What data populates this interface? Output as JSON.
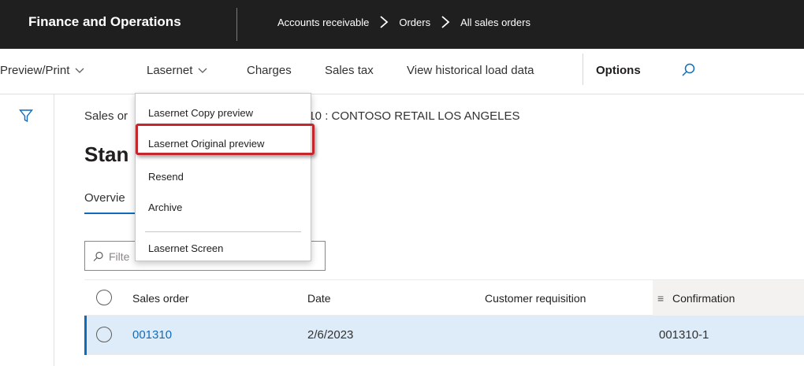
{
  "topbar": {
    "app_title": "Finance and Operations",
    "breadcrumb": [
      "Accounts receivable",
      "Orders",
      "All sales orders"
    ]
  },
  "actions": {
    "preview_print": "Preview/Print",
    "lasernet": "Lasernet",
    "charges": "Charges",
    "sales_tax": "Sales tax",
    "view_historical": "View historical load data",
    "options": "Options"
  },
  "record": {
    "caption_left": "Sales or",
    "caption_right": "310 : CONTOSO RETAIL LOS ANGELES",
    "heading": "Stan"
  },
  "tabs": {
    "overview": "Overvie"
  },
  "filter": {
    "placeholder": "Filte"
  },
  "grid": {
    "headers": [
      "Sales order",
      "Date",
      "Customer requisition",
      "Confirmation"
    ],
    "sort_glyph": "≡",
    "rows": [
      {
        "sales_order": "001310",
        "date": "2/6/2023",
        "customer_requisition": "",
        "confirmation": "001310-1"
      }
    ]
  },
  "dropdown": {
    "items": [
      "Lasernet Copy preview",
      "Lasernet Original preview",
      "Resend",
      "Archive",
      "Lasernet Screen"
    ],
    "highlighted_index": 1
  },
  "icons": {
    "search": "search-icon",
    "filter": "filter-icon",
    "chevron": "chevron-down-icon",
    "breadcrumb_separator": "chevron-right-icon"
  },
  "colors": {
    "topbar": "#1f1f1f",
    "accent": "#0f6cbd",
    "selected_row": "#deecf9",
    "highlight": "#c4262e"
  }
}
